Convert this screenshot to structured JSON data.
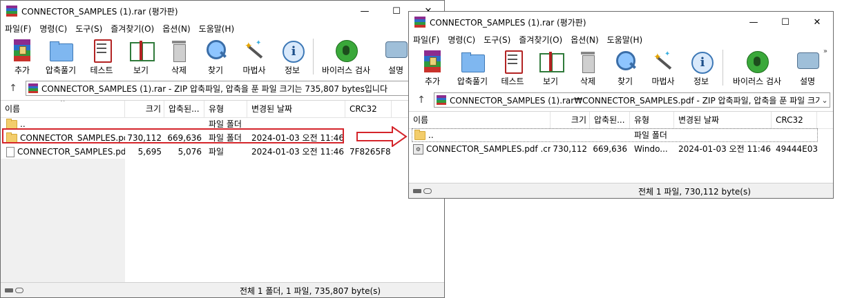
{
  "colors": {
    "highlight": "#d4242a",
    "folder": "#f3cd6b",
    "selection_dotted": "#777777"
  },
  "window1": {
    "title": "CONNECTOR_SAMPLES (1).rar (평가판)",
    "controls": {
      "minimize": "—",
      "maximize": "☐",
      "close": "✕"
    },
    "menu": [
      "파일(F)",
      "명령(C)",
      "도구(S)",
      "즐겨찾기(O)",
      "옵션(N)",
      "도움말(H)"
    ],
    "toolbar": [
      {
        "label": "추가",
        "icon": "add-archive-icon"
      },
      {
        "label": "압축풀기",
        "icon": "extract-folder-icon"
      },
      {
        "label": "테스트",
        "icon": "test-checklist-icon"
      },
      {
        "label": "보기",
        "icon": "view-book-icon"
      },
      {
        "label": "삭제",
        "icon": "delete-trash-icon"
      },
      {
        "label": "찾기",
        "icon": "find-magnifier-icon"
      },
      {
        "label": "마법사",
        "icon": "wizard-wand-icon"
      },
      {
        "label": "정보",
        "icon": "info-icon"
      },
      {
        "label": "바이러스 검사",
        "icon": "virus-scan-icon"
      },
      {
        "label": "설명",
        "icon": "comment-icon"
      }
    ],
    "address": "CONNECTOR_SAMPLES (1).rar - ZIP 압축파일, 압축을 푼 파일 크기는 735,807 bytes입니다",
    "columns": [
      "이름",
      "크기",
      "압축된...",
      "유형",
      "변경된 날짜",
      "CRC32"
    ],
    "rows": [
      {
        "name": "..",
        "size": "",
        "packed": "",
        "type": "파일 폴더",
        "modified": "",
        "crc": "",
        "icon": "folder-icon"
      },
      {
        "name": "CONNECTOR_SAMPLES.pdf",
        "size": "730,112",
        "packed": "669,636",
        "type": "파일 폴더",
        "modified": "2024-01-03 오전 11:46",
        "crc": "",
        "icon": "folder-icon"
      },
      {
        "name": "CONNECTOR_SAMPLES.pdf",
        "size": "5,695",
        "packed": "5,076",
        "type": "파일",
        "modified": "2024-01-03 오전 11:46",
        "crc": "7F8265F8",
        "icon": "file-icon"
      }
    ],
    "status": "전체 1 폴더, 1 파일, 735,807 byte(s)"
  },
  "window2": {
    "title": "CONNECTOR_SAMPLES (1).rar (평가판)",
    "controls": {
      "minimize": "—",
      "maximize": "☐",
      "close": "✕"
    },
    "menu": [
      "파일(F)",
      "명령(C)",
      "도구(S)",
      "즐겨찾기(O)",
      "옵션(N)",
      "도움말(H)"
    ],
    "toolbar": [
      {
        "label": "추가",
        "icon": "add-archive-icon"
      },
      {
        "label": "압축풀기",
        "icon": "extract-folder-icon"
      },
      {
        "label": "테스트",
        "icon": "test-checklist-icon"
      },
      {
        "label": "보기",
        "icon": "view-book-icon"
      },
      {
        "label": "삭제",
        "icon": "delete-trash-icon"
      },
      {
        "label": "찾기",
        "icon": "find-magnifier-icon"
      },
      {
        "label": "마법사",
        "icon": "wizard-wand-icon"
      },
      {
        "label": "정보",
        "icon": "info-icon"
      },
      {
        "label": "바이러스 검사",
        "icon": "virus-scan-icon"
      },
      {
        "label": "설명",
        "icon": "comment-icon"
      }
    ],
    "more": "»",
    "address": "CONNECTOR_SAMPLES (1).rar₩CONNECTOR_SAMPLES.pdf - ZIP 압축파일, 압축을 푼 파일 크기는",
    "columns": [
      "이름",
      "크기",
      "압축된...",
      "유형",
      "변경된 날짜",
      "CRC32"
    ],
    "rows": [
      {
        "name": "..",
        "size": "",
        "packed": "",
        "type": "파일 폴더",
        "modified": "",
        "crc": "",
        "icon": "folder-icon"
      },
      {
        "name": "CONNECTOR_SAMPLES.pdf .cmd",
        "size": "730,112",
        "packed": "669,636",
        "type": "Windo...",
        "modified": "2024-01-03 오전 11:46",
        "crc": "49444E03",
        "icon": "cmd-file-icon"
      }
    ],
    "status": "전체 1 파일, 730,112 byte(s)"
  }
}
